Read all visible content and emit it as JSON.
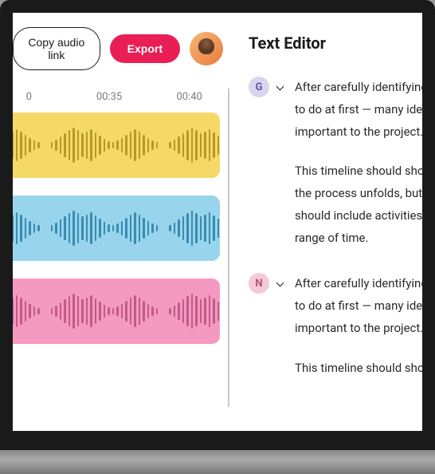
{
  "toolbar": {
    "copy_label": "Copy audio link",
    "export_label": "Export"
  },
  "timeline": {
    "ticks": [
      "0",
      "00:35",
      "00:40"
    ]
  },
  "tracks": [
    {
      "color": "yellow"
    },
    {
      "color": "blue"
    },
    {
      "color": "pink"
    }
  ],
  "editor": {
    "title": "Text Editor",
    "entries": [
      {
        "speaker_initial": "G",
        "badge_class": "badge-purple",
        "paragraphs": [
          "After carefully identifying",
          "to do at first — many ideas",
          "important to the project.",
          "This timeline should show",
          "the process unfolds, but o",
          "should include activities f",
          "range of time."
        ]
      },
      {
        "speaker_initial": "N",
        "badge_class": "badge-pink",
        "paragraphs": [
          "After carefully identifying",
          "to do at first — many ideas",
          "important to the project.",
          "This timeline should show"
        ]
      }
    ]
  },
  "colors": {
    "accent": "#e91e55"
  }
}
